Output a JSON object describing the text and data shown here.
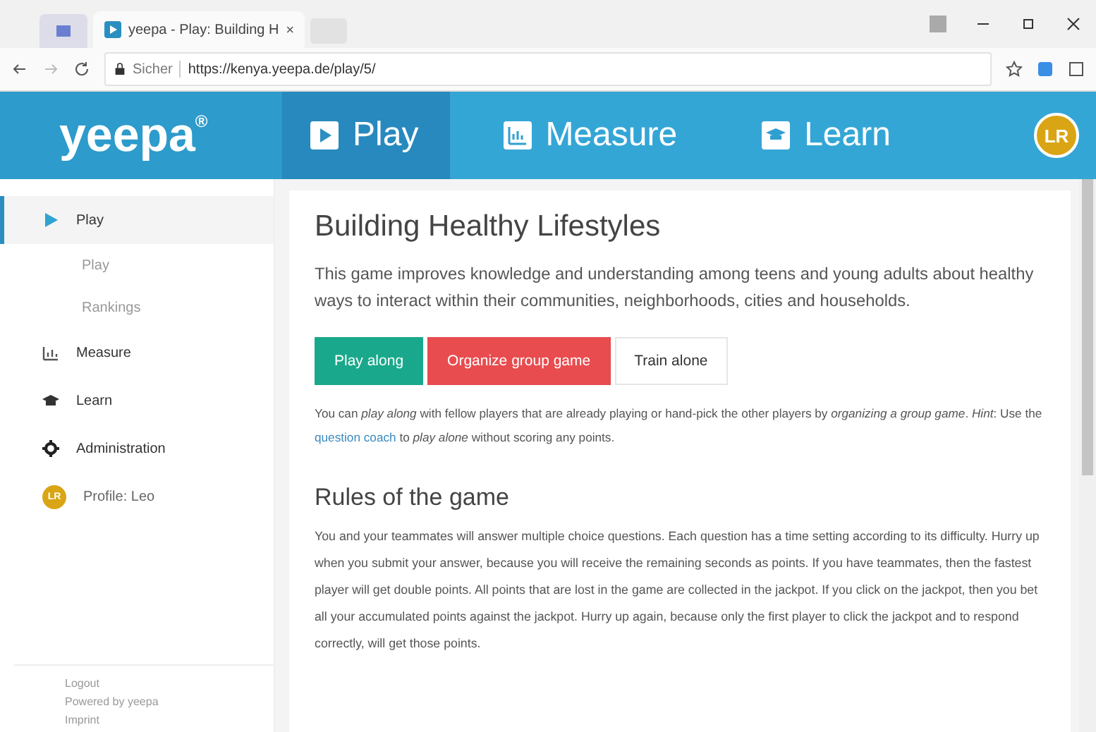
{
  "browser": {
    "tab_title": "yeepa - Play: Building H",
    "url_secure": "Sicher",
    "url": "https://kenya.yeepa.de/play/5/"
  },
  "header": {
    "logo": "yeepa",
    "logo_mark": "®",
    "nav": [
      {
        "label": "Play",
        "selected": true
      },
      {
        "label": "Measure",
        "selected": false
      },
      {
        "label": "Learn",
        "selected": false
      }
    ],
    "avatar": "LR"
  },
  "sidebar": {
    "items": [
      {
        "kind": "section",
        "label": "Play",
        "selected": true
      },
      {
        "kind": "sub",
        "label": "Play",
        "selected": false
      },
      {
        "kind": "sub",
        "label": "Rankings",
        "selected": false
      },
      {
        "kind": "section",
        "label": "Measure",
        "selected": false
      },
      {
        "kind": "section",
        "label": "Learn",
        "selected": false
      },
      {
        "kind": "section",
        "label": "Administration",
        "selected": false
      },
      {
        "kind": "profile",
        "avatar": "LR",
        "label": "Profile: Leo",
        "selected": false
      }
    ],
    "footer": [
      "Logout",
      "Powered by yeepa",
      "Imprint"
    ]
  },
  "main": {
    "title": "Building Healthy Lifestyles",
    "description": "This game improves knowledge and understanding among teens and young adults about healthy ways to interact within their communities, neighborhoods, cities and households.",
    "buttons": [
      {
        "label": "Play along",
        "kind": "primary"
      },
      {
        "label": "Organize group game",
        "kind": "danger"
      },
      {
        "label": "Train alone",
        "kind": "default"
      }
    ],
    "hint": [
      {
        "kind": "text",
        "text": "You can *play along* with fellow players that are already playing or hand-pick the other players by *organizing a group game*. *Hint*: Use the "
      },
      {
        "kind": "link",
        "text": "question coach"
      },
      {
        "kind": "text",
        "text": " to *play alone* without scoring any points."
      }
    ],
    "rules_title": "Rules of the game",
    "rules": "You and your teammates will answer multiple choice questions. Each question has a time setting according to its difficulty. Hurry up when you submit your answer, because you will receive the remaining seconds as points. If you have teammates, then the fastest player will get double points. All points that are lost in the game are collected in the jackpot. If you click on the jackpot, then you bet all your accumulated points against the jackpot. Hurry up again, because only the first player to click the jackpot and to respond correctly, will get those points."
  }
}
